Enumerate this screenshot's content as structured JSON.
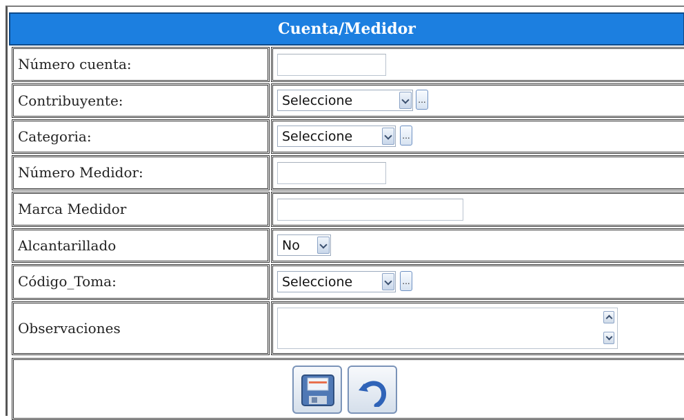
{
  "form": {
    "title": "Cuenta/Medidor",
    "fields": [
      {
        "label": "Número cuenta:",
        "type": "text",
        "value": ""
      },
      {
        "label": "Contribuyente:",
        "type": "select",
        "value": "Seleccione",
        "has_lookup": true
      },
      {
        "label": "Categoria:",
        "type": "select",
        "value": "Seleccione",
        "has_lookup": true
      },
      {
        "label": "Número Medidor:",
        "type": "text",
        "value": ""
      },
      {
        "label": "Marca Medidor",
        "type": "text",
        "value": ""
      },
      {
        "label": "Alcantarillado",
        "type": "select",
        "value": "No"
      },
      {
        "label": "Código_Toma:",
        "type": "select",
        "value": "Seleccione",
        "has_lookup": true
      },
      {
        "label": "Observaciones",
        "type": "textarea",
        "value": ""
      }
    ],
    "lookup_label": "...",
    "actions": {
      "save_icon": "floppy-disk-icon",
      "undo_icon": "undo-arrow-icon"
    }
  },
  "colors": {
    "header_bg": "#1c7fe0",
    "header_text": "#ffffff",
    "border": "#333333"
  }
}
